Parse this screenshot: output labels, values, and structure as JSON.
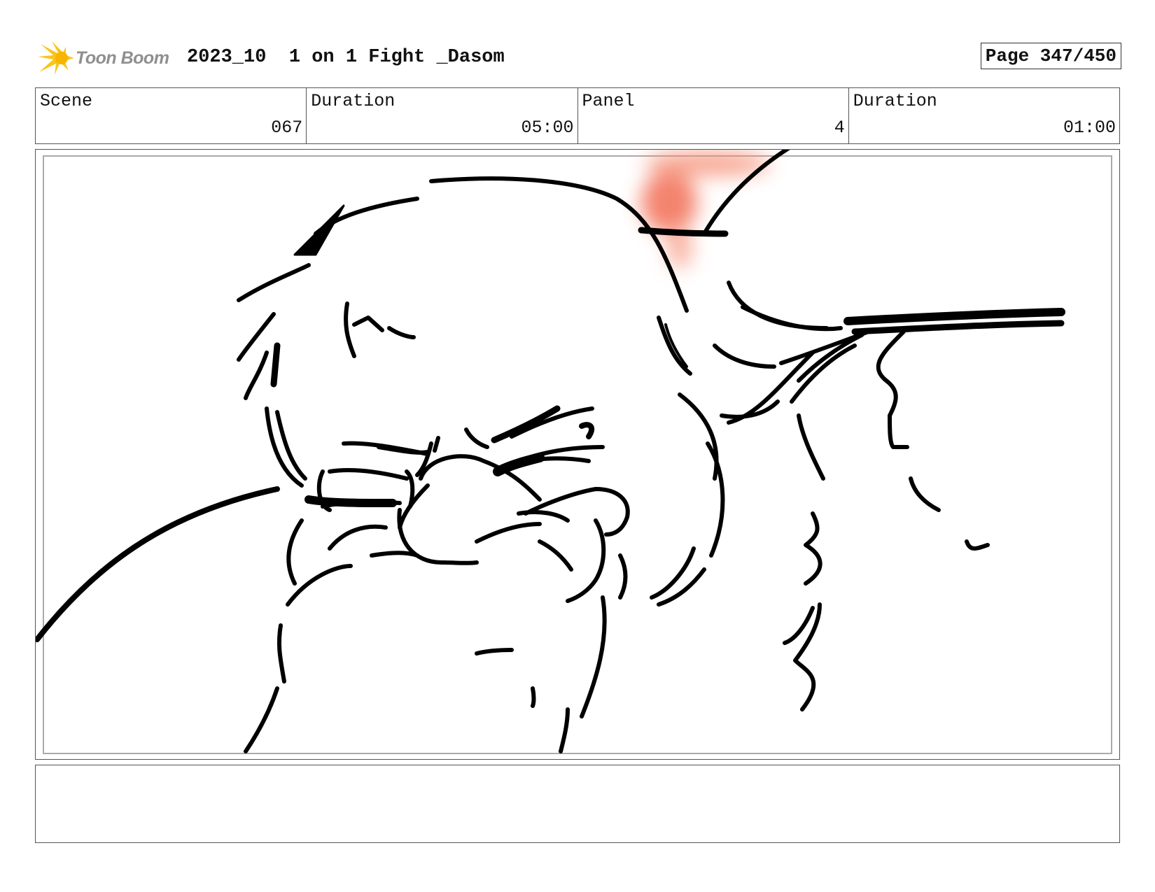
{
  "header": {
    "logo_text": "Toon Boom",
    "title": "2023_10  1 on 1 Fight _Dasom",
    "page": "Page 347/450"
  },
  "info": [
    {
      "label": "Scene",
      "value": "067"
    },
    {
      "label": "Duration",
      "value": "05:00"
    },
    {
      "label": "Panel",
      "value": "4"
    },
    {
      "label": "Duration",
      "value": "01:00"
    }
  ],
  "panel": {
    "sketch_icon": "storyboard-sketch",
    "accent_color": "#f05a3c"
  },
  "notes": {
    "text": ""
  }
}
